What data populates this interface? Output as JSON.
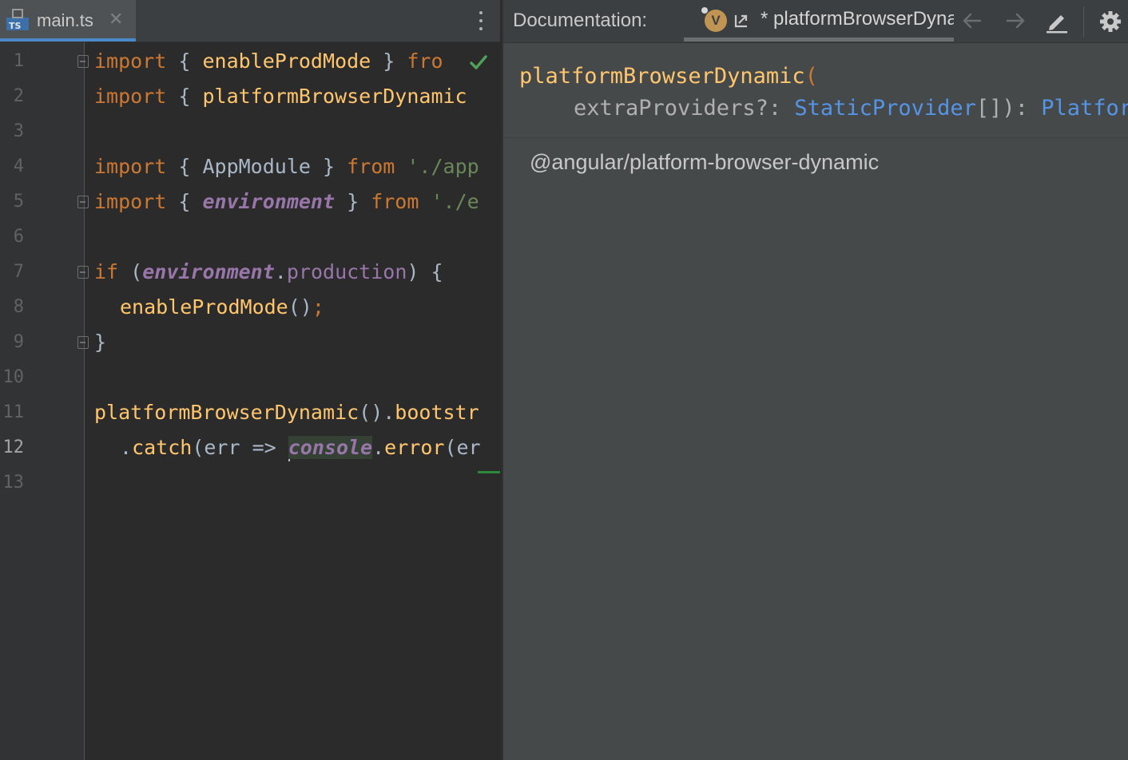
{
  "editor": {
    "tab": {
      "icon_label": "TS",
      "title": "main.ts",
      "close_glyph": "✕"
    },
    "current_line": 12,
    "line_numbers": [
      "1",
      "2",
      "3",
      "4",
      "5",
      "6",
      "7",
      "8",
      "9",
      "10",
      "11",
      "12",
      "13"
    ],
    "lines": {
      "l1": {
        "kw": "import",
        "open": " { ",
        "name": "enableProdMode",
        "close": " } ",
        "from": "fro",
        "tail": "'"
      },
      "l2": {
        "kw": "import",
        "open": " { ",
        "name": "platformBrowserDynamic"
      },
      "l4": {
        "kw": "import",
        "open": " { ",
        "name": "AppModule",
        "close": " } ",
        "from": "from",
        "str": " './app"
      },
      "l5": {
        "kw": "import",
        "open": " { ",
        "name": "environment",
        "close": " } ",
        "from": "from",
        "str": " './e"
      },
      "l7": {
        "kw": "if",
        "open": " (",
        "env": "environment",
        "dot": ".",
        "prop": "production",
        "close": ") {"
      },
      "l8": {
        "name": "enableProdMode",
        "parens": "()",
        "semi": ";"
      },
      "l9": {
        "brace": "}"
      },
      "l11": {
        "name": "platformBrowserDynamic",
        "parens": "().",
        "call": "bootstr"
      },
      "l12": {
        "dot": ".",
        "call": "catch",
        "args": "(err => ",
        "console": "console",
        "dot2": ".",
        "call2": "error",
        "tail": "(er"
      }
    }
  },
  "docs": {
    "label": "Documentation:",
    "badge": "V",
    "tab_title": "* platformBrowserDynamic",
    "icons": [
      "external-link-icon",
      "back-arrow-icon",
      "forward-arrow-icon",
      "edit-icon",
      "gear-icon"
    ],
    "signature": {
      "name": "platformBrowserDynamic",
      "open": "(",
      "param": "extraProviders?: ",
      "param_type": "StaticProvider",
      "array": "[]): ",
      "return_type": "PlatformRef"
    },
    "module": "@angular/platform-browser-dynamic"
  },
  "colors": {
    "keyword": "#cc7832",
    "function": "#ffc66d",
    "string": "#6a8759",
    "field": "#9876aa",
    "type": "#5594e6",
    "editor_bg": "#2b2b2b",
    "docs_bg": "#45494a"
  }
}
